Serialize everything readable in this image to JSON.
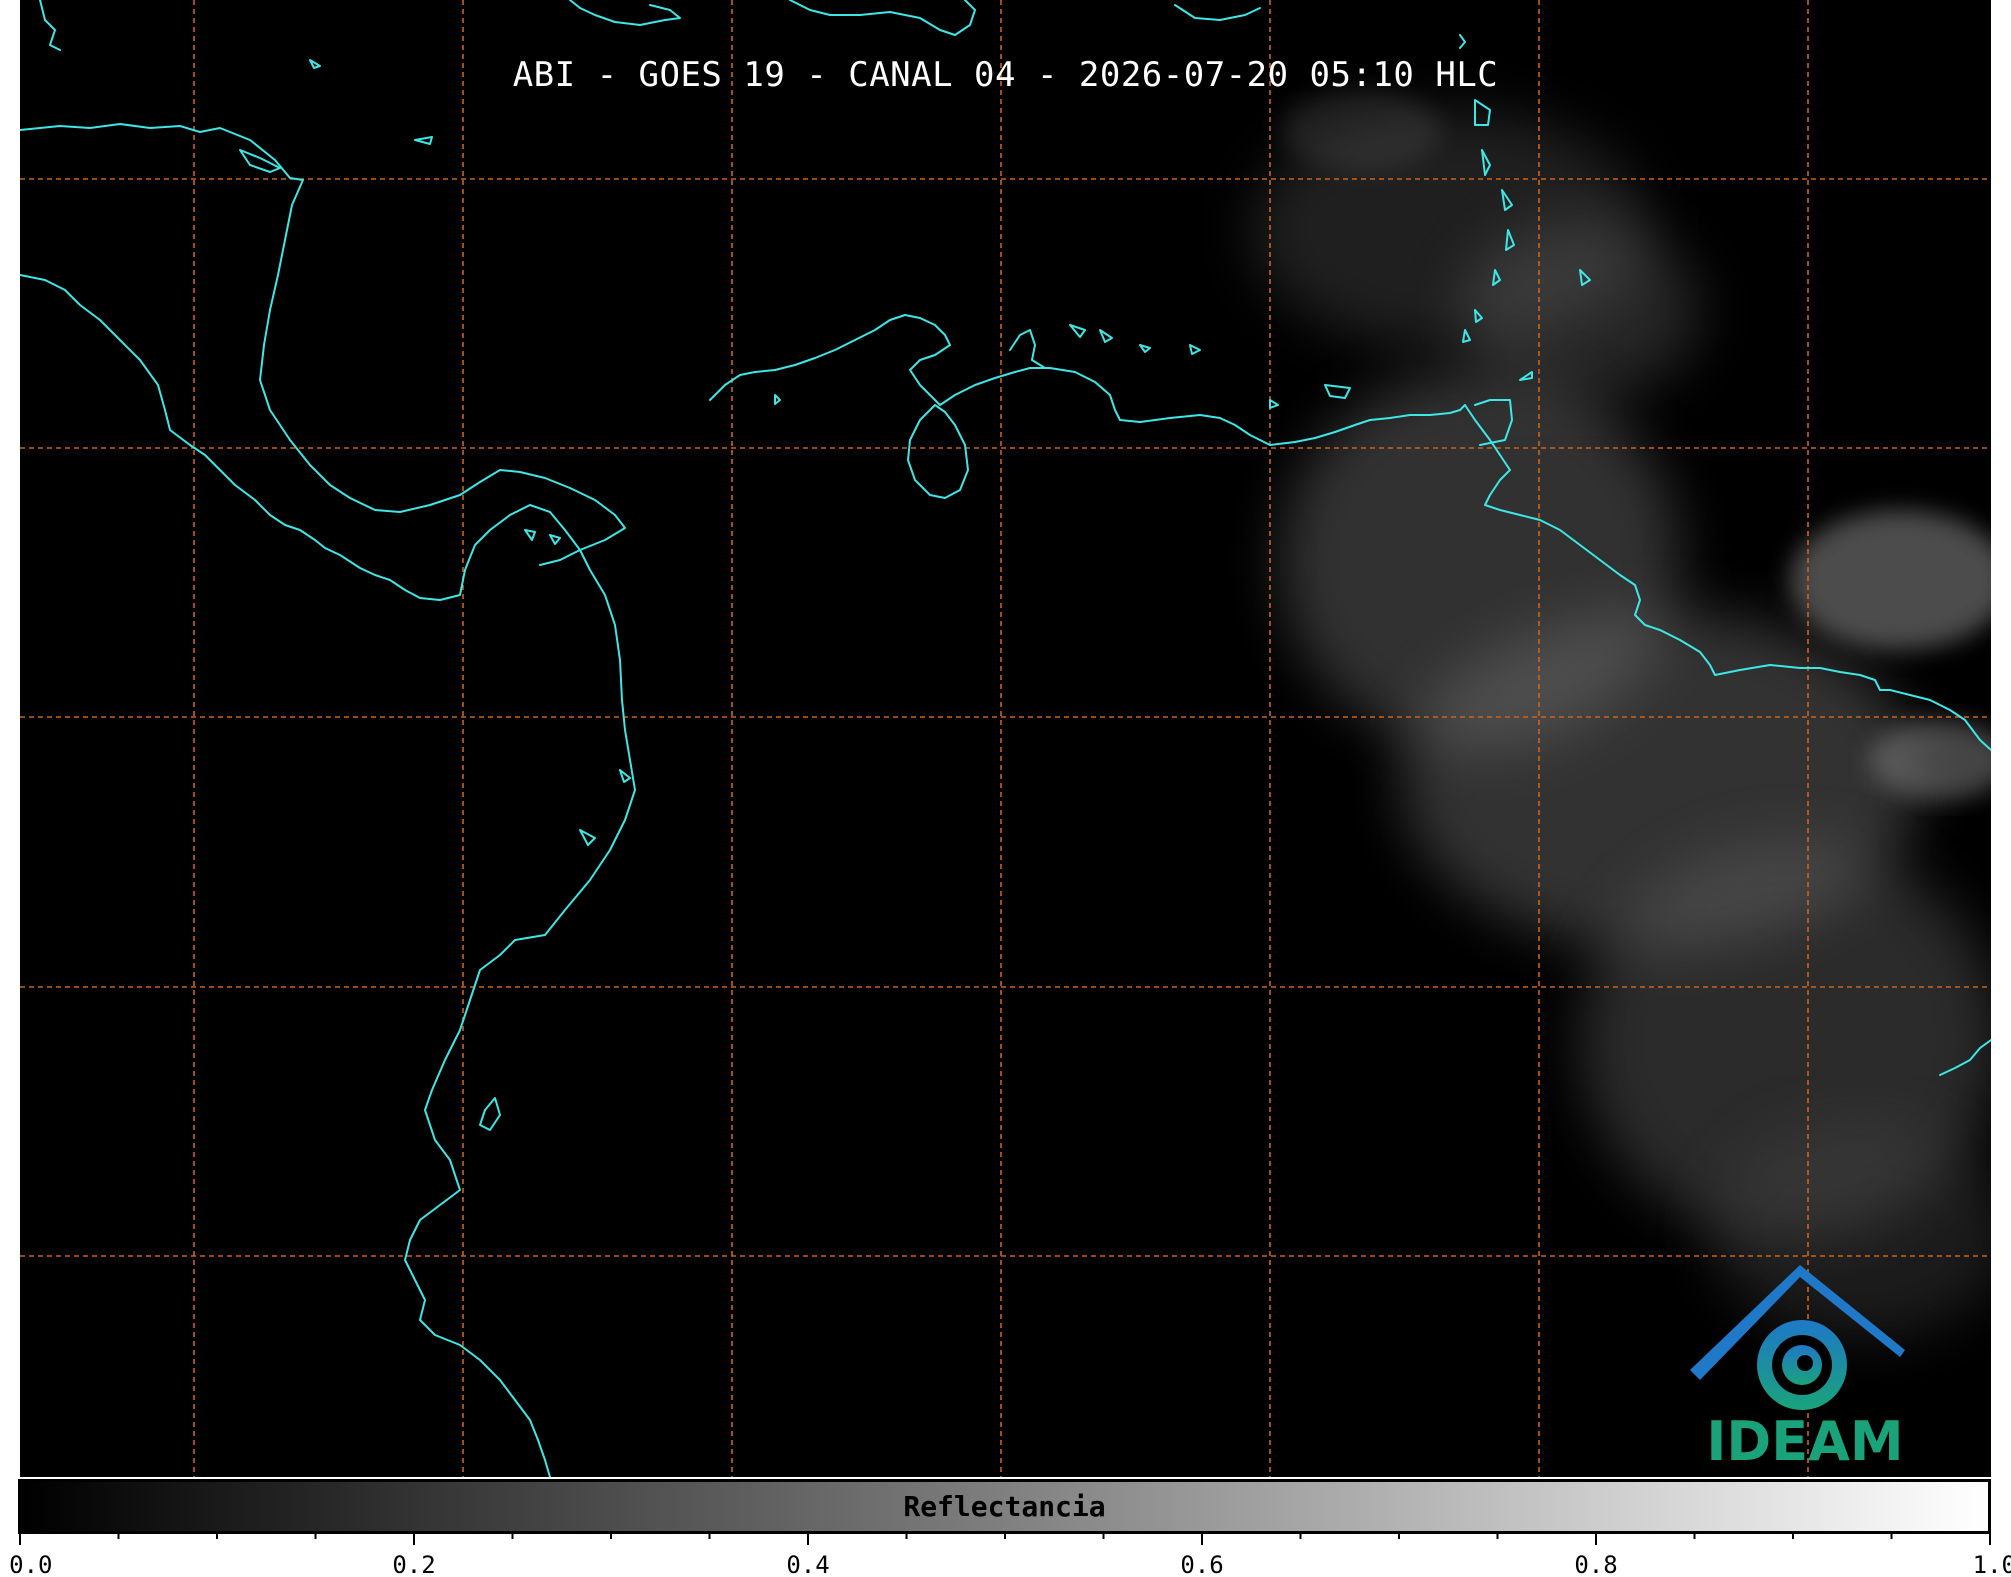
{
  "map": {
    "title": "ABI - GOES 19 - CANAL 04 - 2026-07-20 05:10 HLC",
    "background_color": "#000000",
    "coastline_color": "#3ee6e6",
    "graticule_color": "#c8641e",
    "cloud_color": "#9a9a9a"
  },
  "logo": {
    "text": "IDEAM",
    "icon": "ideam-logo-icon",
    "colors": [
      "#1f78c8",
      "#1aa37a"
    ]
  },
  "colorbar": {
    "label": "Reflectancia",
    "range": [
      0.0,
      1.0
    ],
    "gradient": [
      "#000000",
      "#ffffff"
    ],
    "tick_labels": [
      "0.0",
      "0.2",
      "0.4",
      "0.6",
      "0.8",
      "1.0"
    ]
  }
}
